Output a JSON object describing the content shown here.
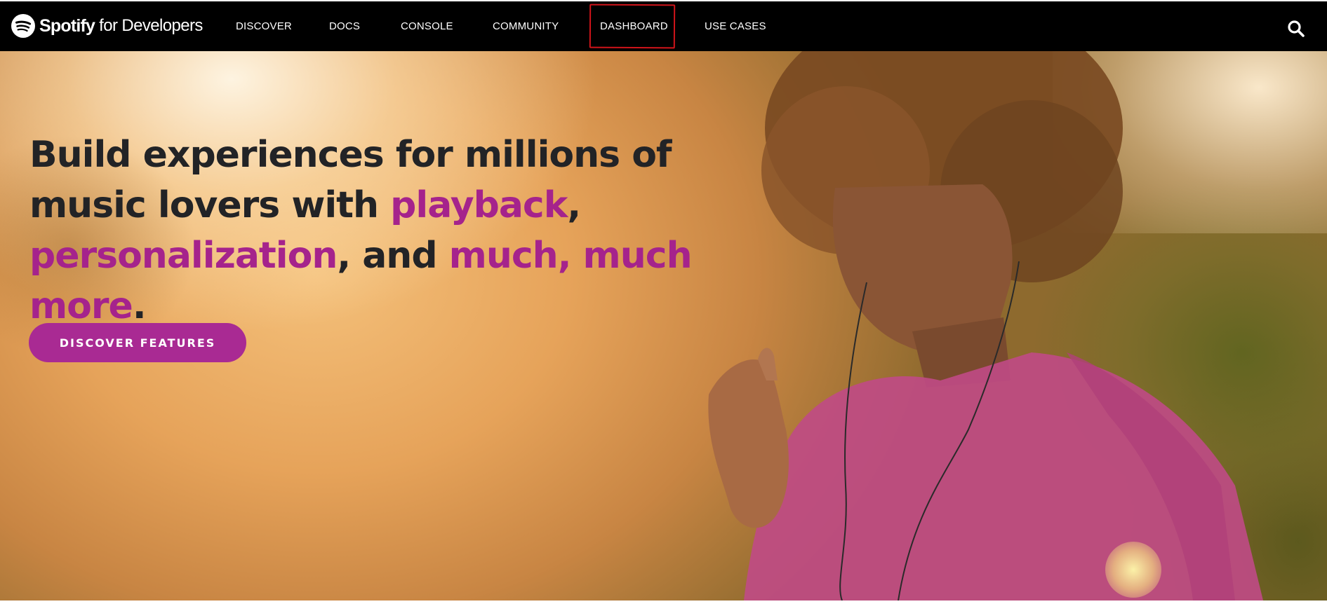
{
  "brand": {
    "name": "Spotify",
    "suffix": "for Developers",
    "logo_icon": "spotify-logo-icon",
    "color": "#1ED760"
  },
  "nav": {
    "items": [
      {
        "label": "DISCOVER"
      },
      {
        "label": "DOCS"
      },
      {
        "label": "CONSOLE"
      },
      {
        "label": "COMMUNITY"
      },
      {
        "label": "DASHBOARD",
        "highlighted": true
      },
      {
        "label": "USE CASES"
      }
    ],
    "search_icon": "search-icon"
  },
  "hero": {
    "headline_parts": [
      "Build experiences for millions of music lovers with ",
      "playback",
      ", ",
      "personalization",
      ", and ",
      "much, much more",
      "."
    ],
    "cta_label": "DISCOVER FEATURES",
    "image_subject": "woman listening to music with earphones, pink hoodie, golden sunlight"
  },
  "colors": {
    "nav_bg": "#000000",
    "headline_text": "#222326",
    "highlight_text": "#A5238C",
    "cta_bg": "#A92A93",
    "cta_text": "#FFFFFF",
    "annotation_box": "#D0141A"
  }
}
